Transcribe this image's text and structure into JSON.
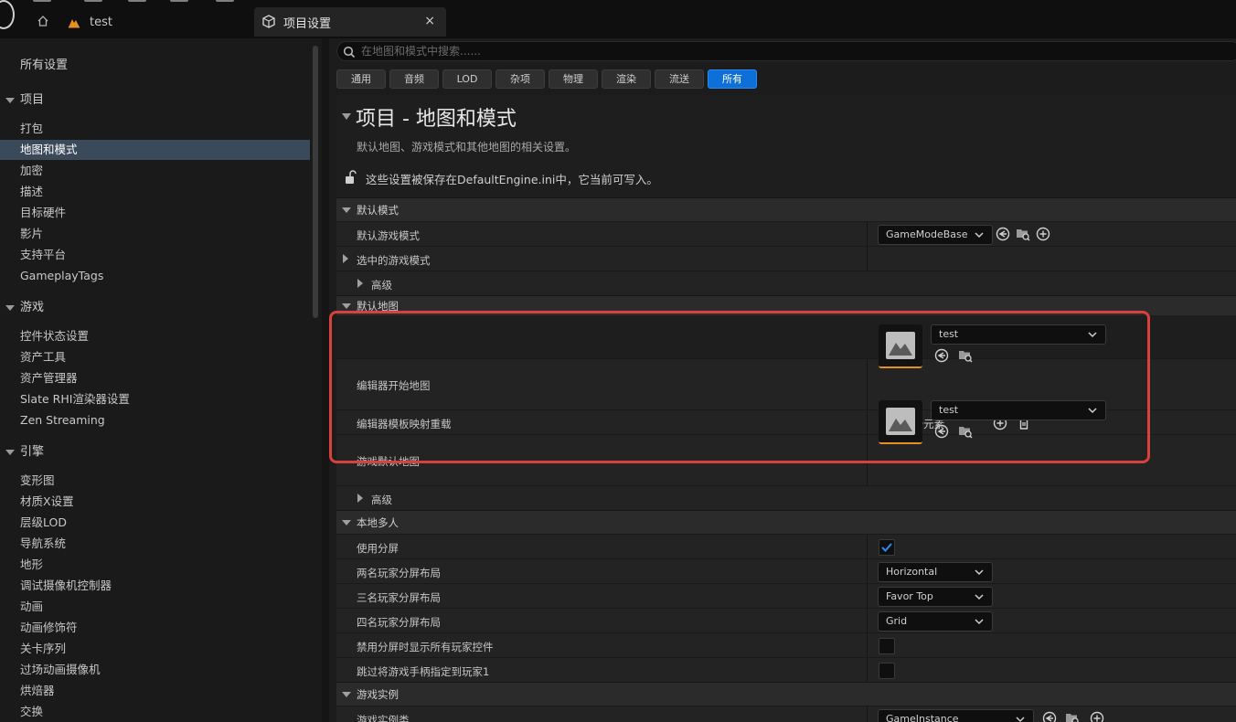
{
  "tabs": {
    "test_label": "test",
    "active_label": "项目设置",
    "close_glyph": "×"
  },
  "sidebar": {
    "all_settings": "所有设置",
    "categories": {
      "project": {
        "label": "项目",
        "items": [
          "打包",
          "地图和模式",
          "加密",
          "描述",
          "目标硬件",
          "影片",
          "支持平台",
          "GameplayTags"
        ],
        "selected": "地图和模式"
      },
      "game": {
        "label": "游戏",
        "items": [
          "控件状态设置",
          "资产工具",
          "资产管理器",
          "Slate RHI渲染器设置",
          "Zen Streaming"
        ]
      },
      "engine": {
        "label": "引擎",
        "items": [
          "变形图",
          "材质X设置",
          "层级LOD",
          "导航系统",
          "地形",
          "调试摄像机控制器",
          "动画",
          "动画修饰符",
          "关卡序列",
          "过场动画摄像机",
          "烘焙器",
          "交换"
        ]
      }
    }
  },
  "search": {
    "placeholder": "在地图和模式中搜索......"
  },
  "filters": {
    "items": [
      "通用",
      "音频",
      "LOD",
      "杂项",
      "物理",
      "渲染",
      "流送",
      "所有"
    ],
    "active": "所有"
  },
  "page": {
    "title": "项目 - 地图和模式",
    "description": "默认地图、游戏模式和其他地图的相关设置。",
    "save_note": "这些设置被保存在DefaultEngine.ini中，它当前可写入。"
  },
  "sections": {
    "default_modes": {
      "label": "默认模式",
      "default_game_mode_label": "默认游戏模式",
      "default_game_mode_value": "GameModeBase",
      "selected_game_mode_label": "选中的游戏模式",
      "advanced_label": "高级"
    },
    "default_maps": {
      "label": "默认地图",
      "editor_startup_map_label": "编辑器开始地图",
      "editor_startup_map_value": "test",
      "editor_template_map_overrides_label": "编辑器模板映射重载",
      "editor_template_map_overrides_value": "0 数组 个元素",
      "game_default_map_label": "游戏默认地图",
      "game_default_map_value": "test",
      "advanced_label": "高级"
    },
    "local_multiplayer": {
      "label": "本地多人",
      "use_splitscreen_label": "使用分屏",
      "use_splitscreen_checked": true,
      "two_player_layout_label": "两名玩家分屏布局",
      "two_player_layout_value": "Horizontal",
      "three_player_layout_label": "三名玩家分屏布局",
      "three_player_layout_value": "Favor Top",
      "four_player_layout_label": "四名玩家分屏布局",
      "four_player_layout_value": "Grid",
      "disable_all_player_widgets_label": "禁用分屏时显示所有玩家控件",
      "skip_assign_gamepad_label": "跳过将游戏手柄指定到玩家1"
    },
    "game_instance": {
      "label": "游戏实例",
      "game_instance_class_label": "游戏实例类",
      "game_instance_class_value": "GameInstance"
    }
  },
  "colors": {
    "accent": "#0f6fd8",
    "selection": "#3b4a5b",
    "highlight_box": "#d9413c",
    "thumb_underline": "#e6911e"
  }
}
